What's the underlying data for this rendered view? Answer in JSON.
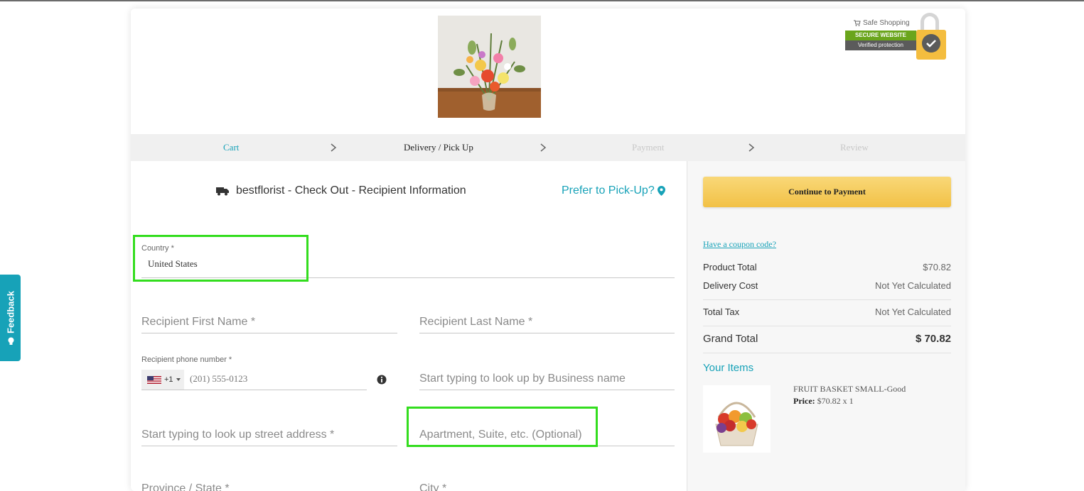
{
  "feedback": {
    "label": "Feedback"
  },
  "badge": {
    "safe": "Safe Shopping",
    "secure": "SECURE WEBSITE",
    "verified": "Verified protection"
  },
  "steps": {
    "cart": "Cart",
    "delivery": "Delivery / Pick Up",
    "payment": "Payment",
    "review": "Review"
  },
  "form": {
    "title": "bestflorist - Check Out - Recipient Information",
    "pickup": "Prefer to Pick-Up?",
    "country_label": "Country *",
    "country_value": "United States",
    "first_name": "Recipient First Name *",
    "last_name": "Recipient Last Name *",
    "phone_label": "Recipient phone number *",
    "phone_code": "+1",
    "phone_placeholder": "(201) 555-0123",
    "business": "Start typing to look up by Business name",
    "street": "Start typing to look up street address *",
    "apartment": "Apartment, Suite, etc. (Optional)",
    "province": "Province / State *",
    "city": "City *"
  },
  "summary": {
    "continue": "Continue to Payment",
    "coupon": "Have a coupon code?",
    "product_total_label": "Product Total",
    "product_total_value": "$70.82",
    "delivery_label": "Delivery Cost",
    "delivery_value": "Not Yet Calculated",
    "tax_label": "Total Tax",
    "tax_value": "Not Yet Calculated",
    "grand_label": "Grand Total",
    "grand_value": "$ 70.82",
    "your_items": "Your Items",
    "item_name": "FRUIT BASKET SMALL-Good",
    "item_price_label": "Price:",
    "item_price_value": "$70.82 x 1"
  },
  "colors": {
    "accent": "#17a2b8",
    "button": "#f2c146",
    "highlight": "#33dd1e",
    "secure_green": "#6aa51c"
  }
}
